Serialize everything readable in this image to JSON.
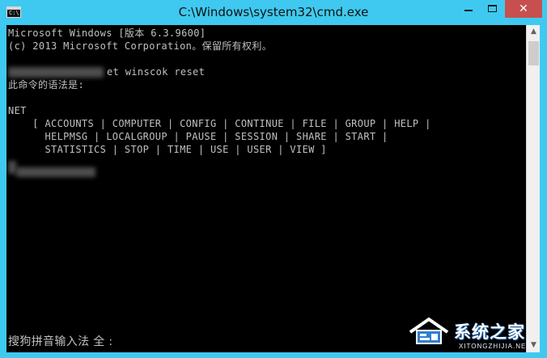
{
  "window": {
    "title": "C:\\Windows\\system32\\cmd.exe",
    "icon_text": "C:\\.",
    "close_glyph": "✕"
  },
  "console": {
    "lines": [
      "Microsoft Windows [版本 6.3.9600]",
      "(c) 2013 Microsoft Corporation。保留所有权利。",
      "et winscok reset",
      "此命令的语法是:",
      "NET",
      "    [ ACCOUNTS | COMPUTER | CONFIG | CONTINUE | FILE | GROUP | HELP |",
      "      HELPMSG | LOCALGROUP | PAUSE | SESSION | SHARE | START |",
      "      STATISTICS | STOP | TIME | USE | USER | VIEW ]"
    ],
    "ime_status": "搜狗拼音输入法 全 :"
  },
  "scrollbar": {
    "up_icon": "▲",
    "down_icon": "▼"
  },
  "watermark": {
    "brand": "系统之家",
    "url": "XITONGZHIJIA.NET"
  },
  "colors": {
    "titlebar": "#3fc9f0",
    "console_bg": "#000000",
    "console_text": "#c0c0c0",
    "close_button": "#c7504f"
  }
}
